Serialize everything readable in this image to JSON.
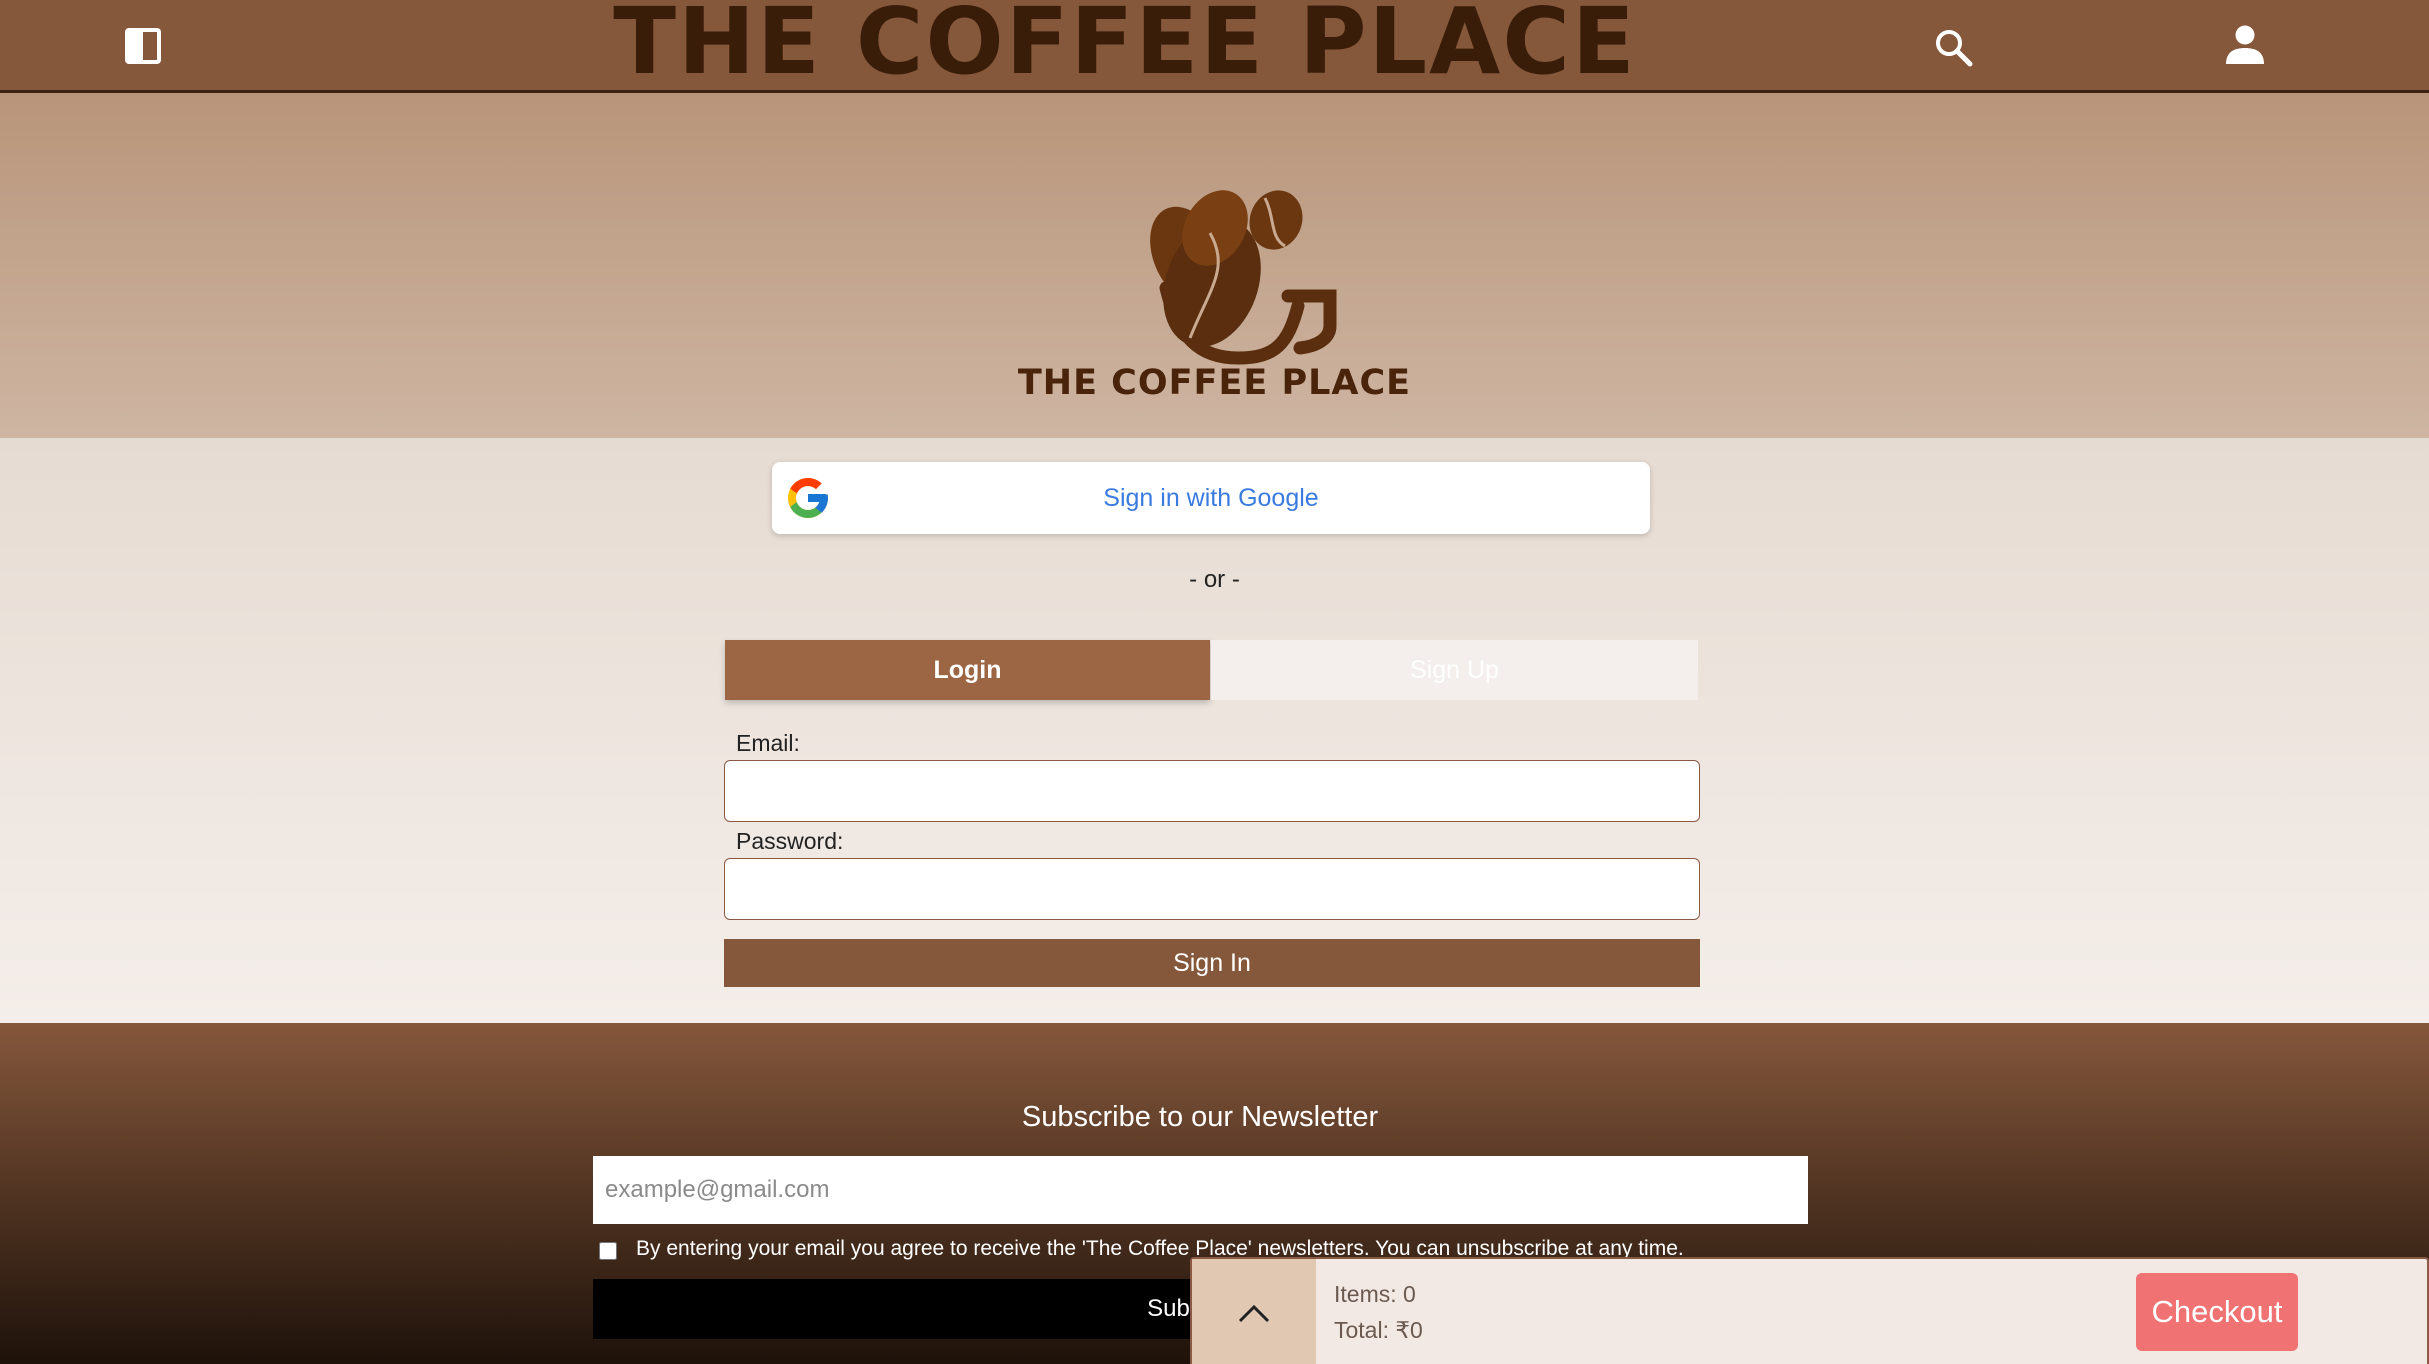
{
  "header": {
    "title": "THE COFFEE PLACE",
    "left_icon": "sidebar-toggle-icon",
    "search_icon": "search-icon",
    "profile_icon": "user-icon"
  },
  "hero": {
    "logo_text": "THE COFFEE PLACE"
  },
  "auth": {
    "google_label": "Sign in with Google",
    "separator": "- or -",
    "tabs": [
      {
        "label": "Login",
        "active": true
      },
      {
        "label": "Sign Up",
        "active": false
      }
    ],
    "email_label": "Email:",
    "email_value": "",
    "password_label": "Password:",
    "password_value": "",
    "submit_label": "Sign In"
  },
  "footer": {
    "newsletter_title": "Subscribe to our Newsletter",
    "email_placeholder": "example@gmail.com",
    "consent_text": "By entering your email you agree to receive the 'The Coffee Place' newsletters. You can unsubscribe at any time.",
    "subscribe_label": "Subscribe"
  },
  "cart": {
    "items_text": "Items: 0",
    "total_text": "Total: ₹0",
    "checkout_label": "Checkout",
    "toggle_icon": "chevron-up-icon"
  },
  "colors": {
    "header_bg": "#85573b",
    "brand_dark": "#3a1d08",
    "google_blue": "#3a7be0",
    "tab_active": "#9c6543",
    "checkout_bg": "#f07272"
  }
}
